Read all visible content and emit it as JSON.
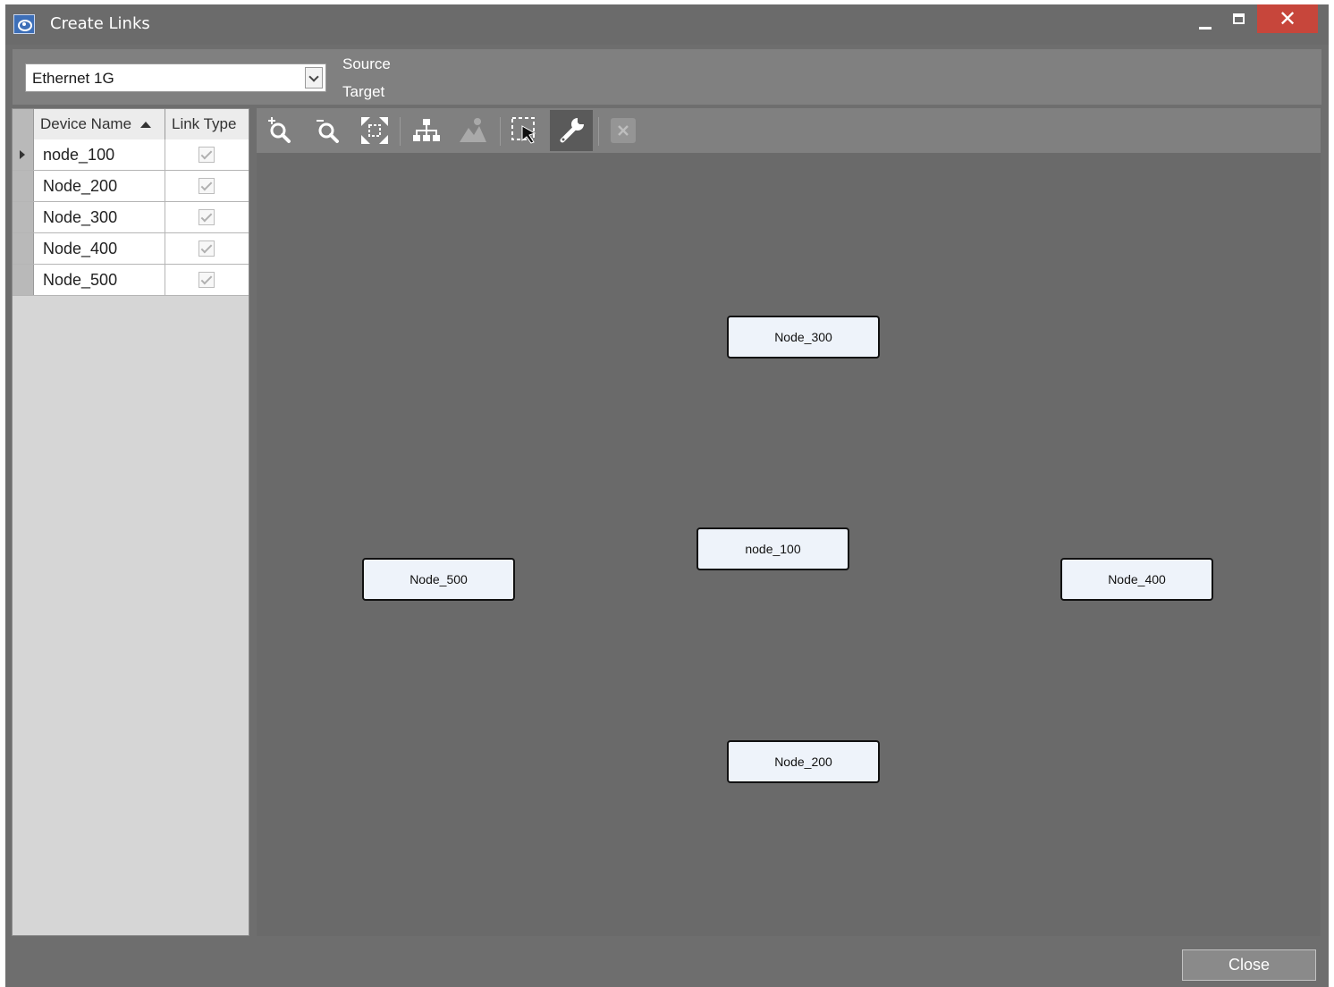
{
  "window": {
    "title": "Create Links",
    "close_symbol": "✕"
  },
  "link_type": {
    "selected": "Ethernet 1G"
  },
  "direction": {
    "source_label": "Source",
    "target_label": "Target"
  },
  "grid": {
    "columns": {
      "device_name": "Device Name",
      "link_type": "Link Type"
    },
    "rows": [
      {
        "name": "node_100",
        "checked": true
      },
      {
        "name": "Node_200",
        "checked": true
      },
      {
        "name": "Node_300",
        "checked": true
      },
      {
        "name": "Node_400",
        "checked": true
      },
      {
        "name": "Node_500",
        "checked": true
      }
    ]
  },
  "toolbar": {
    "tools": [
      "zoom-in-icon",
      "zoom-out-icon",
      "fit-to-screen-icon",
      "hierarchy-layout-icon",
      "image-icon",
      "select-icon",
      "wrench-icon",
      "delete-icon"
    ],
    "active_tool": "wrench-icon"
  },
  "diagram": {
    "nodes": [
      "Node_300",
      "node_100",
      "Node_500",
      "Node_400",
      "Node_200"
    ]
  },
  "footer": {
    "close_label": "Close"
  },
  "colors": {
    "window_bg": "#6e6e6e",
    "canvas_bg": "#6a6a6a",
    "close_accent": "#c7463b",
    "node_fill": "#eef3fa"
  }
}
